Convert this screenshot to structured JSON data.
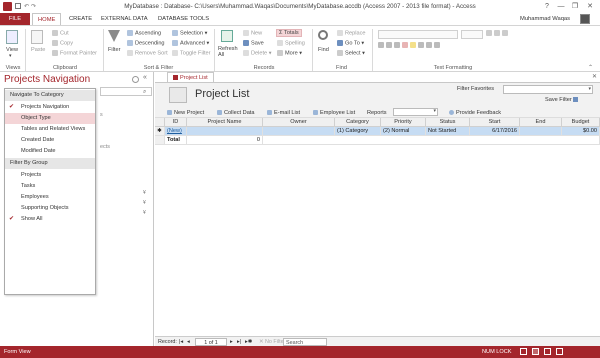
{
  "title": "MyDatabase : Database- C:\\Users\\Muhammad.Waqas\\Documents\\MyDatabase.accdb (Access 2007 - 2013 file format) - Access",
  "window_buttons": [
    "?",
    "—",
    "❐",
    "✕"
  ],
  "user_name": "Muhammad Waqas",
  "ribbon_tabs": [
    "FILE",
    "HOME",
    "CREATE",
    "EXTERNAL DATA",
    "DATABASE TOOLS"
  ],
  "ribbon": {
    "views": {
      "view": "View",
      "label": "Views"
    },
    "clipboard": {
      "paste": "Paste",
      "cut": "Cut",
      "copy": "Copy",
      "format_painter": "Format Painter",
      "label": "Clipboard"
    },
    "sort_filter": {
      "filter": "Filter",
      "ascending": "Ascending",
      "descending": "Descending",
      "remove_sort": "Remove Sort",
      "selection": "Selection",
      "advanced": "Advanced",
      "toggle_filter": "Toggle Filter",
      "label": "Sort & Filter"
    },
    "records": {
      "refresh_all": "Refresh All",
      "new": "New",
      "save": "Save",
      "delete": "Delete",
      "totals": "Totals",
      "spelling": "Spelling",
      "more": "More",
      "label": "Records"
    },
    "find": {
      "find": "Find",
      "replace": "Replace",
      "go_to": "Go To",
      "select": "Select",
      "label": "Find"
    },
    "text_formatting": {
      "label": "Text Formatting"
    }
  },
  "nav_pane": {
    "title": "Projects Navigation",
    "menu_header": "Navigate To Category",
    "items": [
      "Projects Navigation",
      "Object Type",
      "Tables and Related Views",
      "Created Date",
      "Modified Date"
    ],
    "group_header": "Filter By Group",
    "group_items": [
      "Projects",
      "Tasks",
      "Employees",
      "Supporting Objects",
      "Show All"
    ]
  },
  "doc": {
    "tab": "Project List",
    "form_title": "Project List",
    "filter_favorites": "Filter Favorites",
    "save_filter": "Save Filter",
    "commands": [
      "New Project",
      "Collect Data",
      "E-mail List",
      "Employee List",
      "Reports",
      "Provide Feedback"
    ],
    "columns": [
      "ID",
      "Project Name",
      "Owner",
      "Category",
      "Priority",
      "Status",
      "Start",
      "End",
      "Budget"
    ],
    "new_row": [
      "(New)",
      "",
      "",
      "(1) Category",
      "(2) Normal",
      "Not Started",
      "6/17/2016",
      "",
      "$0.00"
    ],
    "total_row": [
      "Total",
      "0"
    ]
  },
  "record_nav": {
    "label": "Record:",
    "position": "1 of 1",
    "filter": "No Filter",
    "search": "Search"
  },
  "status": {
    "left": "Form View",
    "num_lock": "NUM LOCK"
  },
  "colors": {
    "accent": "#a4262c",
    "selected_row": "#c6dcf3"
  }
}
